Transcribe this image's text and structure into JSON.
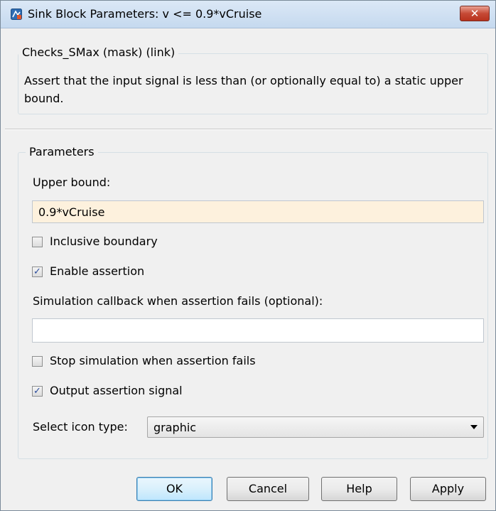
{
  "window": {
    "title": "Sink Block Parameters: v <= 0.9*vCruise",
    "close_label": "✕",
    "app_icon": "simulink-icon"
  },
  "description": {
    "legend": "Checks_SMax (mask) (link)",
    "text": "Assert that the input signal is less than (or optionally equal to) a static upper bound."
  },
  "parameters": {
    "legend": "Parameters",
    "upper_bound_label": "Upper bound:",
    "upper_bound_value": "0.9*vCruise",
    "inclusive_boundary": {
      "label": "Inclusive boundary",
      "checked": false
    },
    "enable_assertion": {
      "label": "Enable assertion",
      "checked": true
    },
    "callback_label": "Simulation callback when assertion fails (optional):",
    "callback_value": "",
    "stop_simulation": {
      "label": "Stop simulation when assertion fails",
      "checked": false
    },
    "output_signal": {
      "label": "Output assertion signal",
      "checked": true
    },
    "icon_type_label": "Select icon type:",
    "icon_type_value": "graphic"
  },
  "buttons": {
    "ok": "OK",
    "cancel": "Cancel",
    "help": "Help",
    "apply": "Apply"
  },
  "colors": {
    "titlebar": "#c5d9ef",
    "close_button": "#c64a36",
    "edited_field": "#fdf1dd"
  }
}
